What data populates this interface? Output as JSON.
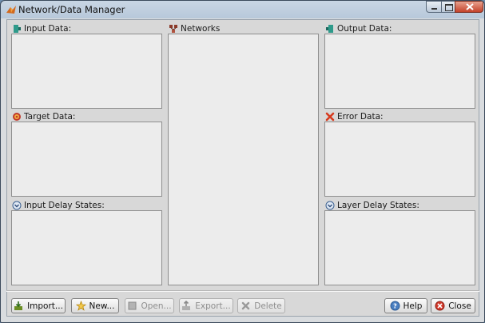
{
  "window": {
    "title": "Network/Data Manager"
  },
  "panels": {
    "input_data": {
      "label": "Input Data:",
      "icon": "input-data-icon"
    },
    "target_data": {
      "label": "Target Data:",
      "icon": "target-icon"
    },
    "input_delay_states": {
      "label": "Input Delay States:",
      "icon": "delay-icon"
    },
    "networks": {
      "label": "Networks",
      "icon": "network-icon"
    },
    "output_data": {
      "label": "Output Data:",
      "icon": "output-data-icon"
    },
    "error_data": {
      "label": "Error Data:",
      "icon": "error-x-icon"
    },
    "layer_delay_states": {
      "label": "Layer Delay States:",
      "icon": "delay-icon"
    }
  },
  "buttons": {
    "import": {
      "label": "Import...",
      "enabled": true
    },
    "new": {
      "label": "New...",
      "enabled": true
    },
    "open": {
      "label": "Open...",
      "enabled": false
    },
    "export": {
      "label": "Export...",
      "enabled": false
    },
    "delete": {
      "label": "Delete",
      "enabled": false
    },
    "help": {
      "label": "Help",
      "enabled": true
    },
    "close": {
      "label": "Close",
      "enabled": true
    }
  }
}
